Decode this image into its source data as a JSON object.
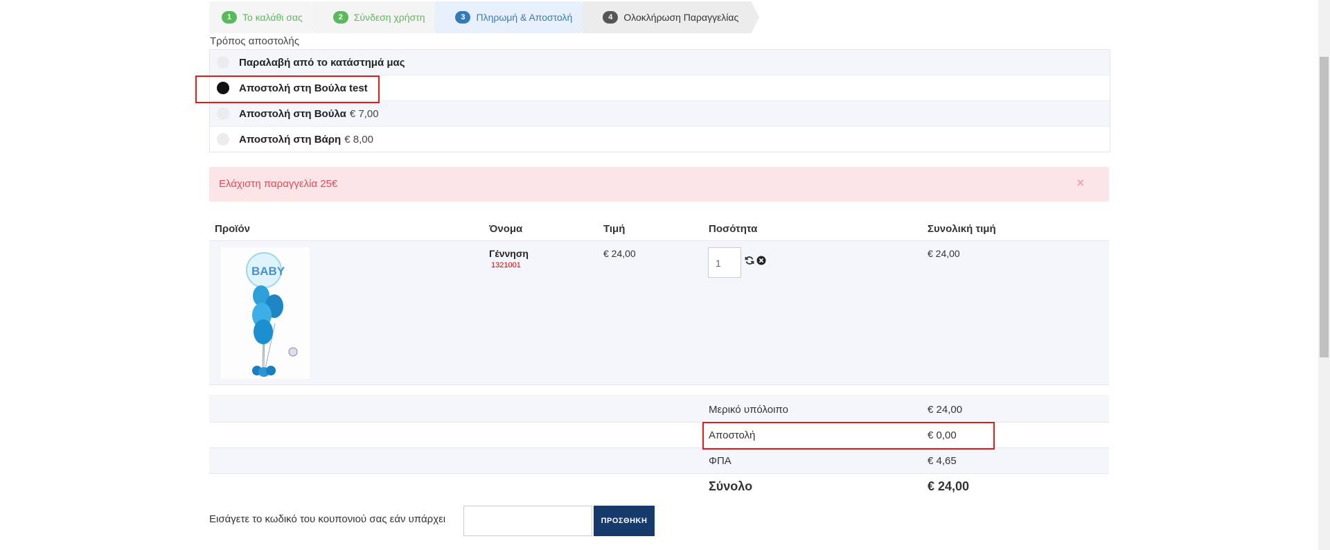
{
  "steps": [
    {
      "num": "1",
      "label": "Το καλάθι σας"
    },
    {
      "num": "2",
      "label": "Σύνδεση χρήστη"
    },
    {
      "num": "3",
      "label": "Πληρωμή & Αποστολή"
    },
    {
      "num": "4",
      "label": "Ολοκλήρωση Παραγγελίας"
    }
  ],
  "shipping": {
    "title": "Τρόπος αποστολής",
    "options": [
      {
        "name": "Παραλαβή από το κατάστημά μας",
        "price": "",
        "selected": false
      },
      {
        "name": "Αποστολή στη Βούλα test",
        "price": "",
        "selected": true
      },
      {
        "name": "Αποστολή στη Βούλα",
        "price": "€ 7,00",
        "selected": false
      },
      {
        "name": "Αποστολή στη Βάρη",
        "price": "€ 8,00",
        "selected": false
      }
    ]
  },
  "alert": {
    "message": "Ελάχιστη παραγγελία 25€",
    "close": "×"
  },
  "table": {
    "headers": {
      "product": "Προϊόν",
      "name": "Όνομα",
      "price": "Τιμή",
      "quantity": "Ποσότητα",
      "total": "Συνολική τιμή"
    },
    "rows": [
      {
        "name": "Γέννηση",
        "code": "1321001",
        "price": "€ 24,00",
        "quantity": "1",
        "total": "€ 24,00"
      }
    ]
  },
  "totals": {
    "subtotal_label": "Μερικό υπόλοιπο",
    "subtotal": "€ 24,00",
    "shipping_label": "Αποστολή",
    "shipping": "€ 0,00",
    "vat_label": "ΦΠΑ",
    "vat": "€ 4,65",
    "grand_label": "Σύνολο",
    "grand": "€ 24,00"
  },
  "coupon": {
    "label": "Εισάγετε το κωδικό του κουπονιού σας εάν υπάρχει",
    "button": "ΠΡΟΣΘΗΚΗ",
    "value": ""
  },
  "icons": {
    "refresh": "refresh-icon",
    "remove": "remove-icon"
  },
  "colors": {
    "step_done": "#5cb85c",
    "step_active": "#337ab7",
    "alert_text": "#e24a5a",
    "button": "#163a6b",
    "highlight": "#e01b1b"
  }
}
